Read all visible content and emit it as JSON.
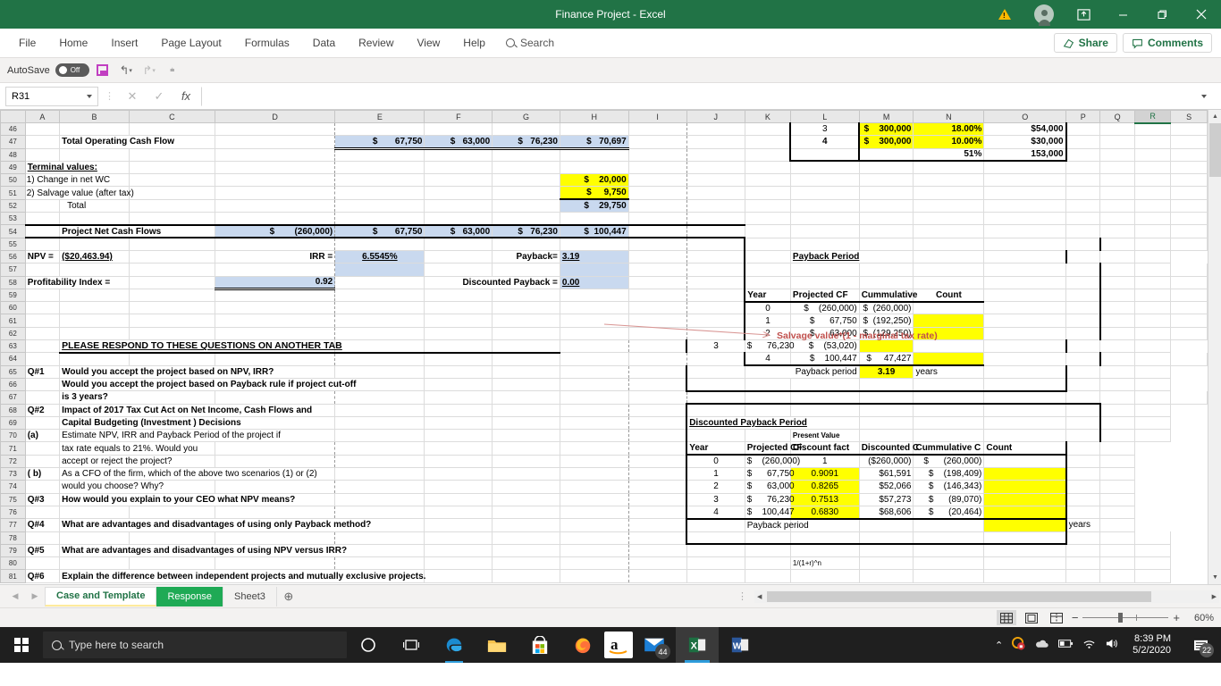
{
  "window": {
    "title": "Finance Project  -  Excel",
    "buttons": {
      "minimize": "—",
      "restore": "❐",
      "close": "✕"
    },
    "icons": {
      "warning": "warning-icon",
      "account": "account-avatar",
      "ribbon_display": "ribbon-display-options-icon"
    }
  },
  "ribbon": {
    "tabs": [
      "File",
      "Home",
      "Insert",
      "Page Layout",
      "Formulas",
      "Data",
      "Review",
      "View",
      "Help"
    ],
    "search_label": "Search",
    "share_label": "Share",
    "comments_label": "Comments"
  },
  "qat": {
    "autosave_label": "AutoSave",
    "autosave_state": "Off",
    "save_icon": "save-icon",
    "undo_icon": "undo-icon",
    "redo_icon": "redo-icon",
    "customize_icon": "customize-qat-icon"
  },
  "formula_bar": {
    "name_box": "R31",
    "cancel": "✕",
    "enter": "✓",
    "fx": "fx",
    "formula_value": ""
  },
  "grid": {
    "columns": [
      "A",
      "B",
      "C",
      "D",
      "E",
      "F",
      "G",
      "H",
      "I",
      "J",
      "K",
      "L",
      "M",
      "N",
      "O",
      "P",
      "Q",
      "R",
      "S"
    ],
    "selected_column": "R",
    "rows": [
      "46",
      "47",
      "48",
      "49",
      "50",
      "51",
      "52",
      "53",
      "54",
      "55",
      "56",
      "57",
      "58",
      "59",
      "60",
      "61",
      "62",
      "63",
      "64",
      "65",
      "66",
      "67",
      "68",
      "69",
      "70",
      "71",
      "72",
      "73",
      "74",
      "75",
      "76",
      "77",
      "78",
      "79",
      "80",
      "81"
    ]
  },
  "sheet": {
    "total_operating_cash_flow": {
      "label": "Total Operating Cash Flow",
      "values": [
        "67,750",
        "63,000",
        "76,230",
        "70,697"
      ]
    },
    "terminal": {
      "header": "Terminal values:",
      "rows": [
        {
          "label": "1) Change in net WC",
          "value": "20,000"
        },
        {
          "label": "2) Salvage value (after tax)",
          "value": "9,750"
        },
        {
          "label": "Total",
          "value": "29,750"
        }
      ]
    },
    "net_cash_flows": {
      "label": "Project Net Cash Flows",
      "values": [
        "(260,000)",
        "67,750",
        "63,000",
        "76,230",
        "100,447"
      ]
    },
    "metrics": {
      "npv_label": "NPV =",
      "npv_value": "($20,463.94)",
      "irr_label": "IRR =",
      "irr_value": "6.5545%",
      "payback_label": "Payback=",
      "payback_value": "3.19",
      "pi_label": "Profitability Index  =",
      "pi_value": "0.92",
      "discounted_payback_label": "Discounted Payback =",
      "discounted_payback_value": "0.00"
    },
    "questions_header": "PLEASE RESPOND TO THESE QUESTIONS ON ANOTHER TAB",
    "questions": [
      {
        "tag": "Q#1",
        "text": "Would you accept the project based on NPV, IRR?"
      },
      {
        "tag": "",
        "text": "Would you accept the project based on Payback rule if project cut-off"
      },
      {
        "tag": "",
        "text": "is 3 years?"
      },
      {
        "tag": "Q#2",
        "text": "Impact of 2017 Tax Cut Act on  Net Income, Cash Flows and"
      },
      {
        "tag": "",
        "text": "Capital Budgeting (Investment ) Decisions"
      },
      {
        "tag": "(a)",
        "text": "Estimate NPV, IRR and Payback Period of the project if"
      },
      {
        "tag": "",
        "text": " tax rate  equals to 21%.  Would you"
      },
      {
        "tag": "",
        "text": "accept  or reject the project?"
      },
      {
        "tag": "( b)",
        "text": "As a CFO of the firm, which of the above two  scenarios (1) or (2)"
      },
      {
        "tag": "",
        "text": "would you choose? Why?"
      },
      {
        "tag": "Q#3",
        "text": "How would you  explain to your CEO what NPV means?"
      },
      {
        "tag": "",
        "text": ""
      },
      {
        "tag": "Q#4",
        "text": "What are  advantages and disadvantages of using only Payback method?"
      },
      {
        "tag": "",
        "text": ""
      },
      {
        "tag": "Q#5",
        "text": "What are advantages and disadvantages of using NPV versus IRR?"
      },
      {
        "tag": "",
        "text": ""
      },
      {
        "tag": "Q#6",
        "text": "Explain the difference between independent projects and mutually exclusive projects."
      }
    ],
    "depreciation": {
      "rows": [
        {
          "year": "3",
          "basis": "300,000",
          "rate": "18.00%",
          "amount": "$54,000"
        },
        {
          "year": "4",
          "basis": "300,000",
          "rate": "10.00%",
          "amount": "$30,000"
        }
      ],
      "total_rate": "51%",
      "total_amount": "153,000"
    },
    "annotation_salvage": "Salvage value*(1 - marginal tax rate)",
    "annotation_discount": "1/(1+r)^n",
    "payback_table": {
      "title": "Payback Period",
      "headers": [
        "Year",
        "Projected CF",
        "Cummulative",
        "Count"
      ],
      "rows": [
        {
          "year": "0",
          "cf": "(260,000)",
          "cum": "(260,000)",
          "count": ""
        },
        {
          "year": "1",
          "cf": "67,750",
          "cum": "(192,250)",
          "count": ""
        },
        {
          "year": "2",
          "cf": "63,000",
          "cum": "(129,250)",
          "count": ""
        },
        {
          "year": "3",
          "cf": "76,230",
          "cum": "(53,020)",
          "count": ""
        },
        {
          "year": "4",
          "cf": "100,447",
          "cum": "47,427",
          "count": ""
        }
      ],
      "footer_label": "Payback period",
      "footer_value": "3.19",
      "footer_unit": "years"
    },
    "discounted_payback_table": {
      "title": "Discounted Payback Period",
      "pv_note": "Present Value",
      "headers": [
        "Year",
        "Projected CF",
        "Discount fact",
        "Discounted C",
        "Cummulative C",
        "Count"
      ],
      "rows": [
        {
          "year": "0",
          "cf": "(260,000)",
          "factor": "1",
          "disc": "($260,000)",
          "cum": "(260,000)",
          "count": ""
        },
        {
          "year": "1",
          "cf": "67,750",
          "factor": "0.9091",
          "disc": "$61,591",
          "cum": "(198,409)",
          "count": ""
        },
        {
          "year": "2",
          "cf": "63,000",
          "factor": "0.8265",
          "disc": "$52,066",
          "cum": "(146,343)",
          "count": ""
        },
        {
          "year": "3",
          "cf": "76,230",
          "factor": "0.7513",
          "disc": "$57,273",
          "cum": "(89,070)",
          "count": ""
        },
        {
          "year": "4",
          "cf": "100,447",
          "factor": "0.6830",
          "disc": "$68,606",
          "cum": "(20,464)",
          "count": ""
        }
      ],
      "footer_label": "Payback period",
      "footer_unit": "years"
    }
  },
  "sheet_tabs": {
    "tabs": [
      "Case and Template",
      "Response",
      "Sheet3"
    ],
    "active": "Case and Template",
    "add_label": "+"
  },
  "status_bar": {
    "views": [
      "normal-view",
      "page-layout-view",
      "page-break-view"
    ],
    "zoom": "60%",
    "zoom_out": "−",
    "zoom_in": "+"
  },
  "taskbar": {
    "search_placeholder": "Type here to search",
    "apps": [
      "cortana-icon",
      "task-view-icon",
      "edge-icon",
      "file-explorer-icon",
      "microsoft-store-icon",
      "firefox-icon",
      "amazon-icon",
      "mail-icon",
      "excel-icon",
      "word-icon"
    ],
    "mail_badge": "44",
    "time": "8:39 PM",
    "date": "5/2/2020",
    "notification_count": "22"
  }
}
